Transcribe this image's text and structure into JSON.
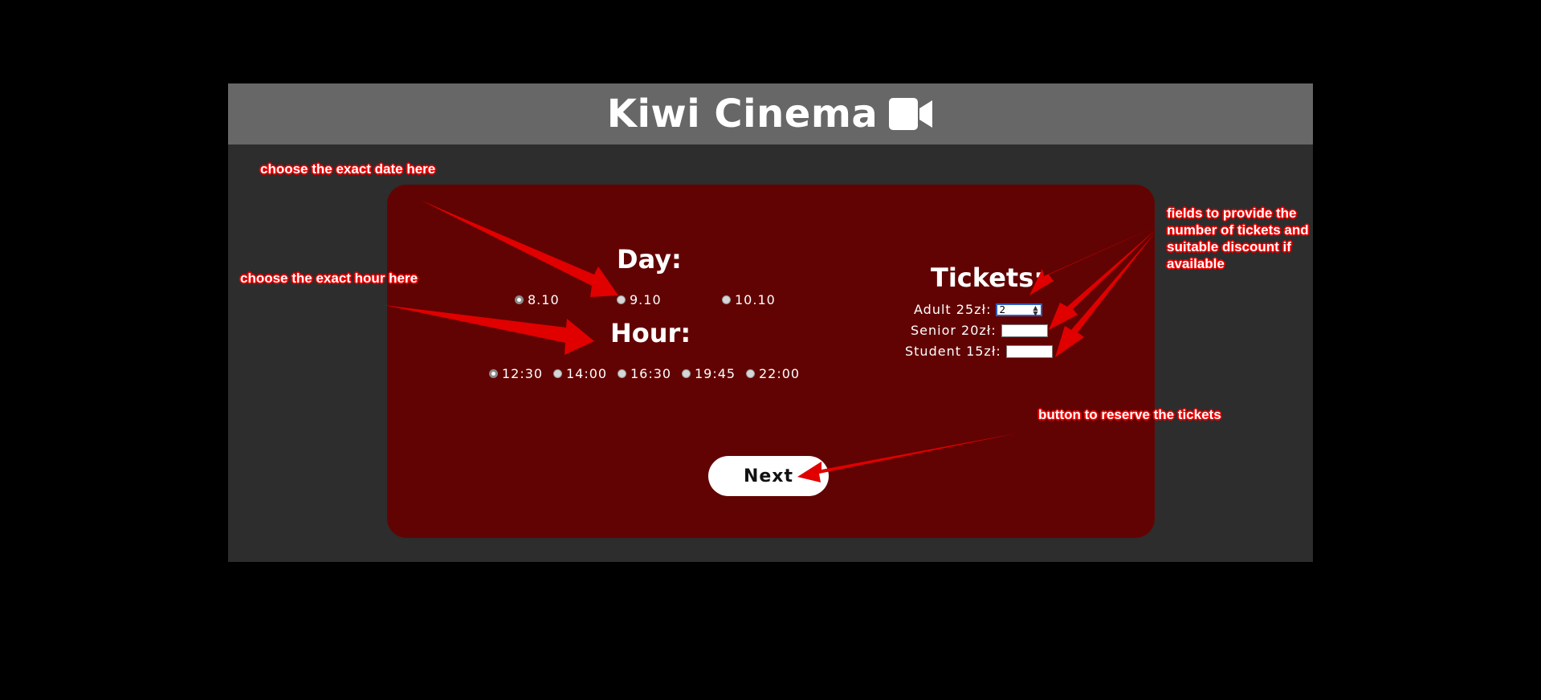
{
  "app": {
    "title": "Kiwi Cinema",
    "icon": "video-camera-icon"
  },
  "day": {
    "heading": "Day:",
    "options": [
      "8.10",
      "9.10",
      "10.10"
    ],
    "selected": "8.10"
  },
  "hour": {
    "heading": "Hour:",
    "options": [
      "12:30",
      "14:00",
      "16:30",
      "19:45",
      "22:00"
    ],
    "selected": "12:30"
  },
  "tickets": {
    "heading": "Tickets:",
    "fields": [
      {
        "label": "Adult 25zł:",
        "value": "2"
      },
      {
        "label": "Senior 20zł:",
        "value": ""
      },
      {
        "label": "Student 15zł:",
        "value": ""
      }
    ]
  },
  "next_label": "Next",
  "annotations": {
    "date": "choose the exact date here",
    "hour": "choose the exact hour here",
    "tickets": "fields to provide the number of tickets and suitable discount if available",
    "button": "button to reserve the tickets"
  },
  "colors": {
    "page_bg": "#000000",
    "frame_bg": "#2d2d2d",
    "header_bg": "#666766",
    "panel_bg": "#620303",
    "annotation_red": "#e60000"
  }
}
